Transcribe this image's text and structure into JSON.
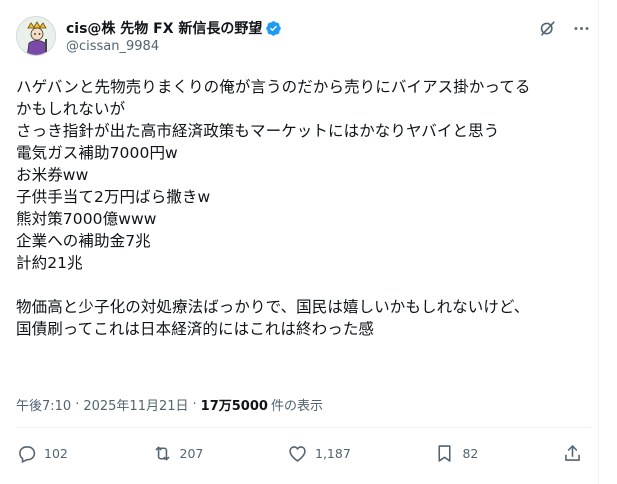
{
  "author": {
    "display_name": "cis@株 先物 FX 新信長の野望",
    "handle": "@cissan_9984"
  },
  "post": {
    "lines": [
      "ハゲバンと先物売りまくりの俺が言うのだから売りにバイアス掛かってる",
      "かもしれないが",
      "さっき指針が出た高市経済政策もマーケットにはかなりヤバイと思う",
      "電気ガス補助7000円w",
      "お米券ww",
      "子供手当て2万円ばら撒きw",
      "熊対策7000億www",
      "企業への補助金7兆",
      "計約21兆",
      "",
      "物価高と少子化の対処療法ばっかりで、国民は嬉しいかもしれないけど、",
      "国債刷ってこれは日本経済的にはこれは終わった感"
    ]
  },
  "meta": {
    "time": "午後7:10",
    "separator": "·",
    "date": "2025年11月21日",
    "views_count": "17万5000",
    "views_label": "件の表示"
  },
  "actions": {
    "reply_count": "102",
    "repost_count": "207",
    "like_count": "1,187",
    "bookmark_count": "82"
  },
  "colors": {
    "text": "#0f1419",
    "secondary": "#536471",
    "verified": "#1d9bf0",
    "border": "#eff3f4"
  },
  "icons": [
    "verified-badge-icon",
    "grok-icon",
    "more-icon",
    "reply-icon",
    "repost-icon",
    "like-icon",
    "bookmark-icon",
    "share-icon"
  ]
}
